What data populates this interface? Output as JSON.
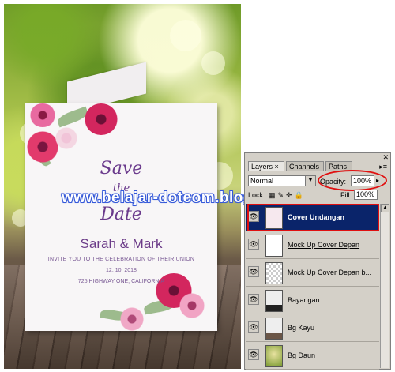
{
  "canvas": {
    "card": {
      "title_line1": "Save",
      "title_line2": "the",
      "title_line3": "Date",
      "names": "Sarah & Mark",
      "invite": "INVITE YOU TO THE CELEBRATION OF THEIR UNION",
      "date": "12. 10. 2018",
      "address": "725 HIGHWAY ONE, CALIFORNIA"
    },
    "watermark": "www.belajar-dotcom.blogspot.com"
  },
  "panel": {
    "tabs": [
      {
        "label": "Layers ×",
        "active": true
      },
      {
        "label": "Channels",
        "active": false
      },
      {
        "label": "Paths",
        "active": false
      }
    ],
    "blend_mode": "Normal",
    "opacity_label": "Opacity:",
    "opacity_value": "100%",
    "lock_label": "Lock:",
    "fill_label": "Fill:",
    "fill_value": "100%",
    "layers": [
      {
        "name": "Cover Undangan",
        "selected": true
      },
      {
        "name": "Mock Up Cover Depan",
        "selected": false
      },
      {
        "name": "Mock Up Cover Depan b...",
        "selected": false
      },
      {
        "name": "Bayangan",
        "selected": false
      },
      {
        "name": "Bg Kayu",
        "selected": false
      },
      {
        "name": "Bg Daun",
        "selected": false
      }
    ],
    "highlight_color": "#e01010",
    "selection_color": "#0a246a"
  }
}
